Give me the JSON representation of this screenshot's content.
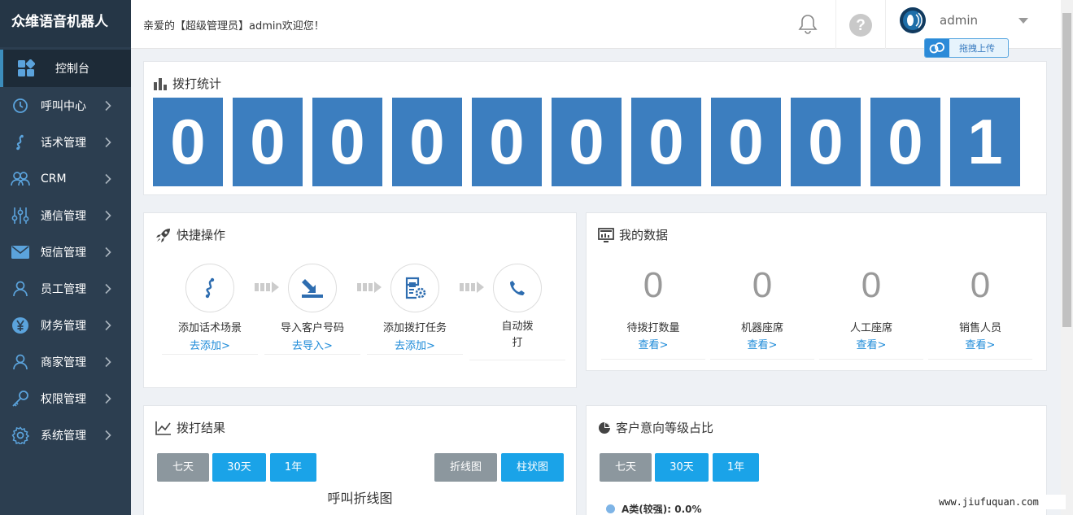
{
  "app": {
    "brand": "众维语音机器人"
  },
  "sidebar": {
    "items": [
      {
        "label": "控制台",
        "icon": "dashboard-icon",
        "active": true
      },
      {
        "label": "呼叫中心",
        "icon": "clock-icon"
      },
      {
        "label": "话术管理",
        "icon": "script-icon"
      },
      {
        "label": "CRM",
        "icon": "users-icon"
      },
      {
        "label": "通信管理",
        "icon": "sliders-icon"
      },
      {
        "label": "短信管理",
        "icon": "mail-icon"
      },
      {
        "label": "员工管理",
        "icon": "user-icon"
      },
      {
        "label": "财务管理",
        "icon": "yen-icon"
      },
      {
        "label": "商家管理",
        "icon": "user-icon"
      },
      {
        "label": "权限管理",
        "icon": "key-icon"
      },
      {
        "label": "系统管理",
        "icon": "gear-icon"
      }
    ]
  },
  "header": {
    "welcome": "亲爱的【超级管理员】admin欢迎您！",
    "username": "admin",
    "upload_label": "拖拽上传"
  },
  "dial_stats": {
    "title": "拨打统计",
    "digits": [
      "0",
      "0",
      "0",
      "0",
      "0",
      "0",
      "0",
      "0",
      "0",
      "0",
      "1"
    ]
  },
  "quick_ops": {
    "title": "快捷操作",
    "steps": [
      {
        "label": "添加话术场景",
        "link": "去添加>",
        "icon": "script-icon"
      },
      {
        "label": "导入客户号码",
        "link": "去导入>",
        "icon": "import-icon"
      },
      {
        "label": "添加拨打任务",
        "link": "去添加>",
        "icon": "task-settings-icon"
      },
      {
        "label": "自动拨打",
        "link": "",
        "icon": "phone-icon"
      }
    ]
  },
  "my_data": {
    "title": "我的数据",
    "stats": [
      {
        "value": "0",
        "label": "待拨打数量",
        "link": "查看>"
      },
      {
        "value": "0",
        "label": "机器座席",
        "link": "查看>"
      },
      {
        "value": "0",
        "label": "人工座席",
        "link": "查看>"
      },
      {
        "value": "0",
        "label": "销售人员",
        "link": "查看>"
      }
    ]
  },
  "dial_result": {
    "title": "拨打结果",
    "periods": [
      "七天",
      "30天",
      "1年"
    ],
    "chart_types": [
      "折线图",
      "柱状图"
    ],
    "chart_title": "呼叫折线图"
  },
  "customer_level": {
    "title": "客户意向等级占比",
    "periods": [
      "七天",
      "30天",
      "1年"
    ],
    "legend_first": "A类(较强): 0.0%"
  },
  "watermark": "www.jiufuquan.com",
  "colors": {
    "sidebar": "#2c3e50",
    "digit": "#3c7ebf",
    "button_blue": "#1aa3e8",
    "button_gray": "#8c979e",
    "link": "#1c8ad8"
  }
}
